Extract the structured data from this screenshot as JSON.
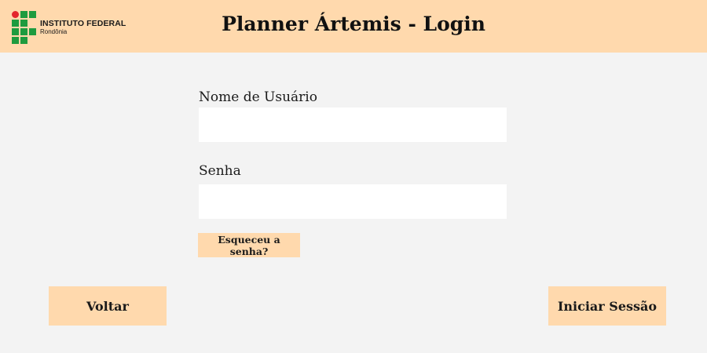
{
  "header": {
    "logo": {
      "icon": "instituto-federal-logo-icon",
      "title": "INSTITUTO FEDERAL",
      "subtitle": "Rondônia",
      "colors": {
        "green": "#1e9b3f",
        "red": "#e3262c"
      }
    },
    "title": "Planner Ártemis - Login",
    "background": "#ffd9ad"
  },
  "form": {
    "username": {
      "label": "Nome de Usuário",
      "value": "",
      "placeholder": ""
    },
    "password": {
      "label": "Senha",
      "value": "",
      "placeholder": ""
    },
    "forgot_label": "Esqueceu a senha?"
  },
  "actions": {
    "back_label": "Voltar",
    "login_label": "Iniciar Sessão"
  },
  "colors": {
    "page_background": "#f3f3f3",
    "accent": "#ffd9ad",
    "input_background": "#ffffff"
  }
}
